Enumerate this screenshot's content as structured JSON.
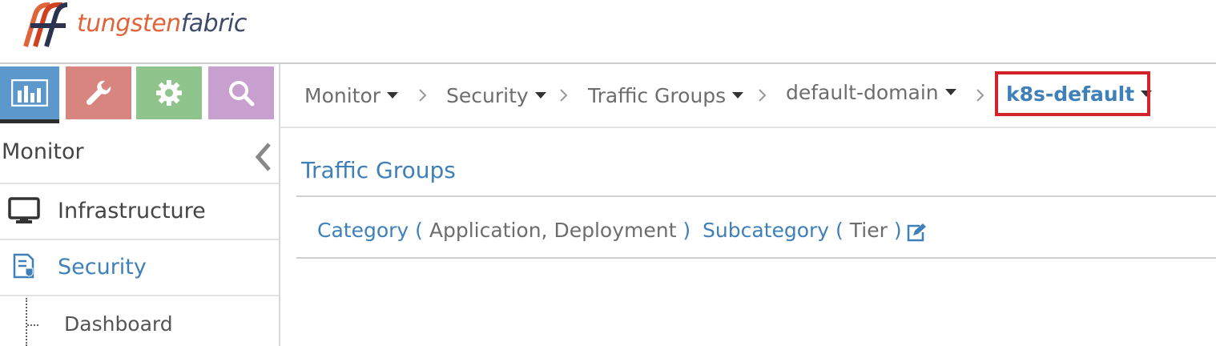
{
  "header": {
    "logo_part1": "tungsten",
    "logo_part2": "fabric"
  },
  "nav": {
    "tiles": [
      {
        "name": "monitor",
        "icon": "bar-chart-icon",
        "color": "#5d98cc",
        "active": true
      },
      {
        "name": "configure",
        "icon": "wrench-icon",
        "color": "#d9857f"
      },
      {
        "name": "settings",
        "icon": "gear-icon",
        "color": "#8fc58c"
      },
      {
        "name": "query",
        "icon": "search-icon",
        "color": "#c8a0d0"
      }
    ]
  },
  "sidebar": {
    "title": "Monitor",
    "items": [
      {
        "label": "Infrastructure",
        "icon": "monitor-icon"
      },
      {
        "label": "Security",
        "icon": "security-icon",
        "active": true
      }
    ],
    "subitem": "Dashboard"
  },
  "breadcrumb": {
    "items": [
      {
        "label": "Monitor"
      },
      {
        "label": "Security"
      },
      {
        "label": "Traffic Groups"
      },
      {
        "label": "default-domain"
      },
      {
        "label": "k8s-default",
        "active": true
      }
    ],
    "separator": "›"
  },
  "main": {
    "title": "Traffic Groups",
    "filters": {
      "category_key": "Category",
      "category_val": "Application, Deployment",
      "subcategory_key": "Subcategory",
      "subcategory_val": "Tier",
      "open_paren": "(",
      "close_paren": ")"
    }
  },
  "colors": {
    "accent": "#3f80b9",
    "highlight_box": "#d2232a"
  }
}
